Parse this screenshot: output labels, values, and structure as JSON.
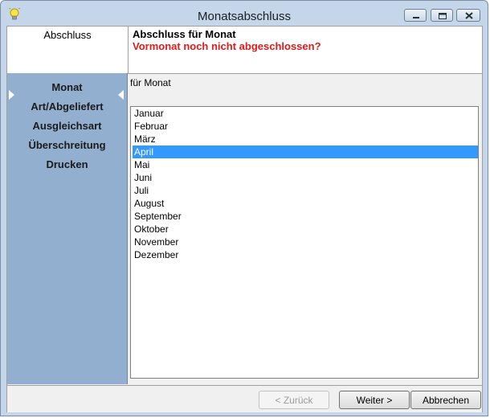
{
  "window": {
    "title": "Monatsabschluss"
  },
  "header": {
    "section": "Abschluss",
    "title": "Abschluss für Monat",
    "warning": "Vormonat noch nicht abgeschlossen?"
  },
  "sidebar": {
    "items": [
      {
        "label": "Monat",
        "active": true
      },
      {
        "label": "Art/Abgeliefert"
      },
      {
        "label": "Ausgleichsart"
      },
      {
        "label": "Überschreitung"
      },
      {
        "label": "Drucken"
      }
    ]
  },
  "content": {
    "label": "für Monat",
    "months": [
      "Januar",
      "Februar",
      "März",
      "April",
      "Mai",
      "Juni",
      "Juli",
      "August",
      "September",
      "Oktober",
      "November",
      "Dezember"
    ],
    "selected": "April"
  },
  "footer": {
    "back_label": "< Zurück",
    "next_label": "Weiter >",
    "cancel_label": "Abbrechen"
  },
  "colors": {
    "sidebar": "#93afd0",
    "selection": "#3399ff",
    "warning": "#e21b1b"
  },
  "icons": {
    "app": "lightbulb-icon",
    "minimize": "minimize-icon",
    "maximize": "maximize-icon",
    "close": "close-icon"
  }
}
